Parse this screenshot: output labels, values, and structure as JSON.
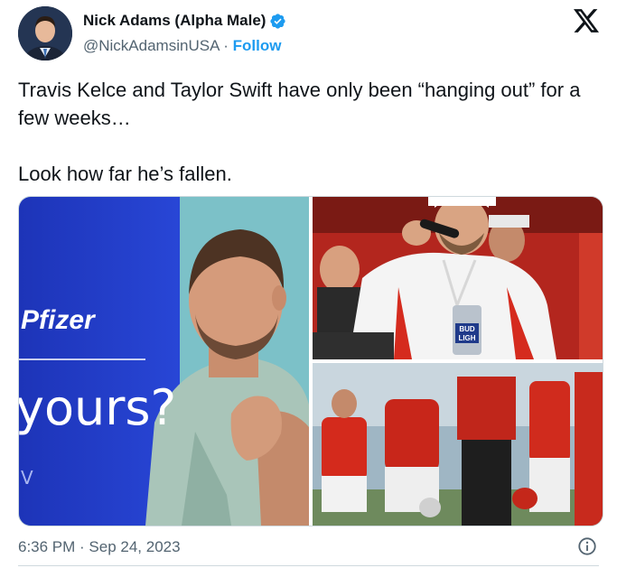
{
  "tweet": {
    "author": {
      "display_name": "Nick Adams (Alpha Male)",
      "handle": "@NickAdamsinUSA",
      "separator": "·",
      "follow_label": "Follow",
      "verified": true,
      "avatar_icon": "user-avatar-photo"
    },
    "text": "Travis Kelce and Taylor Swift have only been “hanging out” for a few weeks…\n\nLook how far he’s fallen.",
    "media": {
      "left_image": {
        "overlay_brand": "Pfizer",
        "overlay_text": "yours?",
        "overlay_corner": "V"
      },
      "top_right_image": {
        "can_label_line1": "BUD",
        "can_label_line2": "LIGH"
      },
      "bottom_right_image": {}
    },
    "timestamp": "6:36 PM · Sep 24, 2023",
    "icons": {
      "verified": "verified-badge-icon",
      "logo": "x-logo-icon",
      "info": "info-icon"
    },
    "colors": {
      "link": "#1d9bf0",
      "secondary_text": "#536471",
      "primary_text": "#0f1419",
      "verified_badge": "#1d9bf0"
    }
  }
}
